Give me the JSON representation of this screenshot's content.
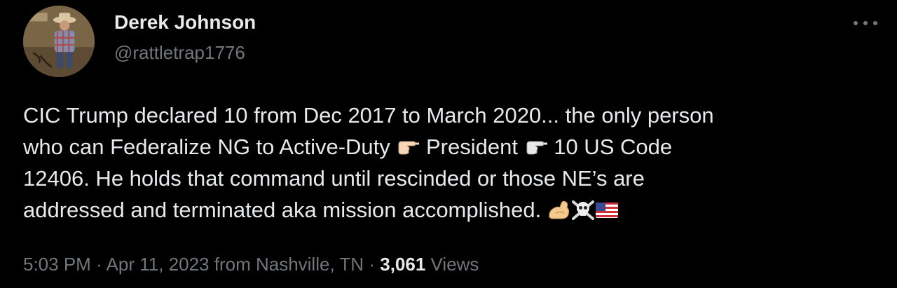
{
  "author": {
    "name": "Derek Johnson",
    "handle": "@rattletrap1776",
    "avatar_icon": "profile-photo-cowboy-avatar"
  },
  "more_icon": "more-horizontal-icon",
  "tweet": {
    "lines": [
      {
        "text": "CIC Trump declared 10 from Dec 2017 to March 2020... the only person"
      },
      {
        "part1": "who can Federalize NG to Active-Duty ",
        "emoji1": "backhand-index-pointing-right-emoji",
        "part2": " President ",
        "emoji2": "backhand-index-pointing-right-emoji",
        "part3": " 10 US Code"
      },
      {
        "text": "12406. He holds that command until rescinded or those NE’s are"
      },
      {
        "part1": "addressed and terminated aka mission accomplished. ",
        "emojis": [
          "flexed-biceps-emoji",
          "skull-and-crossbones-emoji",
          "us-flag-emoji"
        ]
      }
    ]
  },
  "meta": {
    "time": "5:03 PM",
    "separator": "·",
    "date": "Apr 11, 2023",
    "location": "from Nashville, TN",
    "views_count": "3,061",
    "views_label": "Views"
  },
  "colors": {
    "background": "#000000",
    "primary_text": "#e7e9ea",
    "secondary_text": "#71767b"
  }
}
